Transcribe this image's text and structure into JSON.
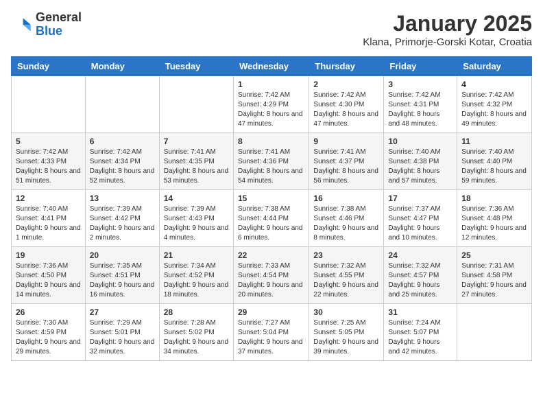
{
  "logo": {
    "general": "General",
    "blue": "Blue"
  },
  "header": {
    "title": "January 2025",
    "subtitle": "Klana, Primorje-Gorski Kotar, Croatia"
  },
  "weekdays": [
    "Sunday",
    "Monday",
    "Tuesday",
    "Wednesday",
    "Thursday",
    "Friday",
    "Saturday"
  ],
  "weeks": [
    [
      {
        "day": "",
        "detail": ""
      },
      {
        "day": "",
        "detail": ""
      },
      {
        "day": "",
        "detail": ""
      },
      {
        "day": "1",
        "detail": "Sunrise: 7:42 AM\nSunset: 4:29 PM\nDaylight: 8 hours and 47 minutes."
      },
      {
        "day": "2",
        "detail": "Sunrise: 7:42 AM\nSunset: 4:30 PM\nDaylight: 8 hours and 47 minutes."
      },
      {
        "day": "3",
        "detail": "Sunrise: 7:42 AM\nSunset: 4:31 PM\nDaylight: 8 hours and 48 minutes."
      },
      {
        "day": "4",
        "detail": "Sunrise: 7:42 AM\nSunset: 4:32 PM\nDaylight: 8 hours and 49 minutes."
      }
    ],
    [
      {
        "day": "5",
        "detail": "Sunrise: 7:42 AM\nSunset: 4:33 PM\nDaylight: 8 hours and 51 minutes."
      },
      {
        "day": "6",
        "detail": "Sunrise: 7:42 AM\nSunset: 4:34 PM\nDaylight: 8 hours and 52 minutes."
      },
      {
        "day": "7",
        "detail": "Sunrise: 7:41 AM\nSunset: 4:35 PM\nDaylight: 8 hours and 53 minutes."
      },
      {
        "day": "8",
        "detail": "Sunrise: 7:41 AM\nSunset: 4:36 PM\nDaylight: 8 hours and 54 minutes."
      },
      {
        "day": "9",
        "detail": "Sunrise: 7:41 AM\nSunset: 4:37 PM\nDaylight: 8 hours and 56 minutes."
      },
      {
        "day": "10",
        "detail": "Sunrise: 7:40 AM\nSunset: 4:38 PM\nDaylight: 8 hours and 57 minutes."
      },
      {
        "day": "11",
        "detail": "Sunrise: 7:40 AM\nSunset: 4:40 PM\nDaylight: 8 hours and 59 minutes."
      }
    ],
    [
      {
        "day": "12",
        "detail": "Sunrise: 7:40 AM\nSunset: 4:41 PM\nDaylight: 9 hours and 1 minute."
      },
      {
        "day": "13",
        "detail": "Sunrise: 7:39 AM\nSunset: 4:42 PM\nDaylight: 9 hours and 2 minutes."
      },
      {
        "day": "14",
        "detail": "Sunrise: 7:39 AM\nSunset: 4:43 PM\nDaylight: 9 hours and 4 minutes."
      },
      {
        "day": "15",
        "detail": "Sunrise: 7:38 AM\nSunset: 4:44 PM\nDaylight: 9 hours and 6 minutes."
      },
      {
        "day": "16",
        "detail": "Sunrise: 7:38 AM\nSunset: 4:46 PM\nDaylight: 9 hours and 8 minutes."
      },
      {
        "day": "17",
        "detail": "Sunrise: 7:37 AM\nSunset: 4:47 PM\nDaylight: 9 hours and 10 minutes."
      },
      {
        "day": "18",
        "detail": "Sunrise: 7:36 AM\nSunset: 4:48 PM\nDaylight: 9 hours and 12 minutes."
      }
    ],
    [
      {
        "day": "19",
        "detail": "Sunrise: 7:36 AM\nSunset: 4:50 PM\nDaylight: 9 hours and 14 minutes."
      },
      {
        "day": "20",
        "detail": "Sunrise: 7:35 AM\nSunset: 4:51 PM\nDaylight: 9 hours and 16 minutes."
      },
      {
        "day": "21",
        "detail": "Sunrise: 7:34 AM\nSunset: 4:52 PM\nDaylight: 9 hours and 18 minutes."
      },
      {
        "day": "22",
        "detail": "Sunrise: 7:33 AM\nSunset: 4:54 PM\nDaylight: 9 hours and 20 minutes."
      },
      {
        "day": "23",
        "detail": "Sunrise: 7:32 AM\nSunset: 4:55 PM\nDaylight: 9 hours and 22 minutes."
      },
      {
        "day": "24",
        "detail": "Sunrise: 7:32 AM\nSunset: 4:57 PM\nDaylight: 9 hours and 25 minutes."
      },
      {
        "day": "25",
        "detail": "Sunrise: 7:31 AM\nSunset: 4:58 PM\nDaylight: 9 hours and 27 minutes."
      }
    ],
    [
      {
        "day": "26",
        "detail": "Sunrise: 7:30 AM\nSunset: 4:59 PM\nDaylight: 9 hours and 29 minutes."
      },
      {
        "day": "27",
        "detail": "Sunrise: 7:29 AM\nSunset: 5:01 PM\nDaylight: 9 hours and 32 minutes."
      },
      {
        "day": "28",
        "detail": "Sunrise: 7:28 AM\nSunset: 5:02 PM\nDaylight: 9 hours and 34 minutes."
      },
      {
        "day": "29",
        "detail": "Sunrise: 7:27 AM\nSunset: 5:04 PM\nDaylight: 9 hours and 37 minutes."
      },
      {
        "day": "30",
        "detail": "Sunrise: 7:25 AM\nSunset: 5:05 PM\nDaylight: 9 hours and 39 minutes."
      },
      {
        "day": "31",
        "detail": "Sunrise: 7:24 AM\nSunset: 5:07 PM\nDaylight: 9 hours and 42 minutes."
      },
      {
        "day": "",
        "detail": ""
      }
    ]
  ]
}
